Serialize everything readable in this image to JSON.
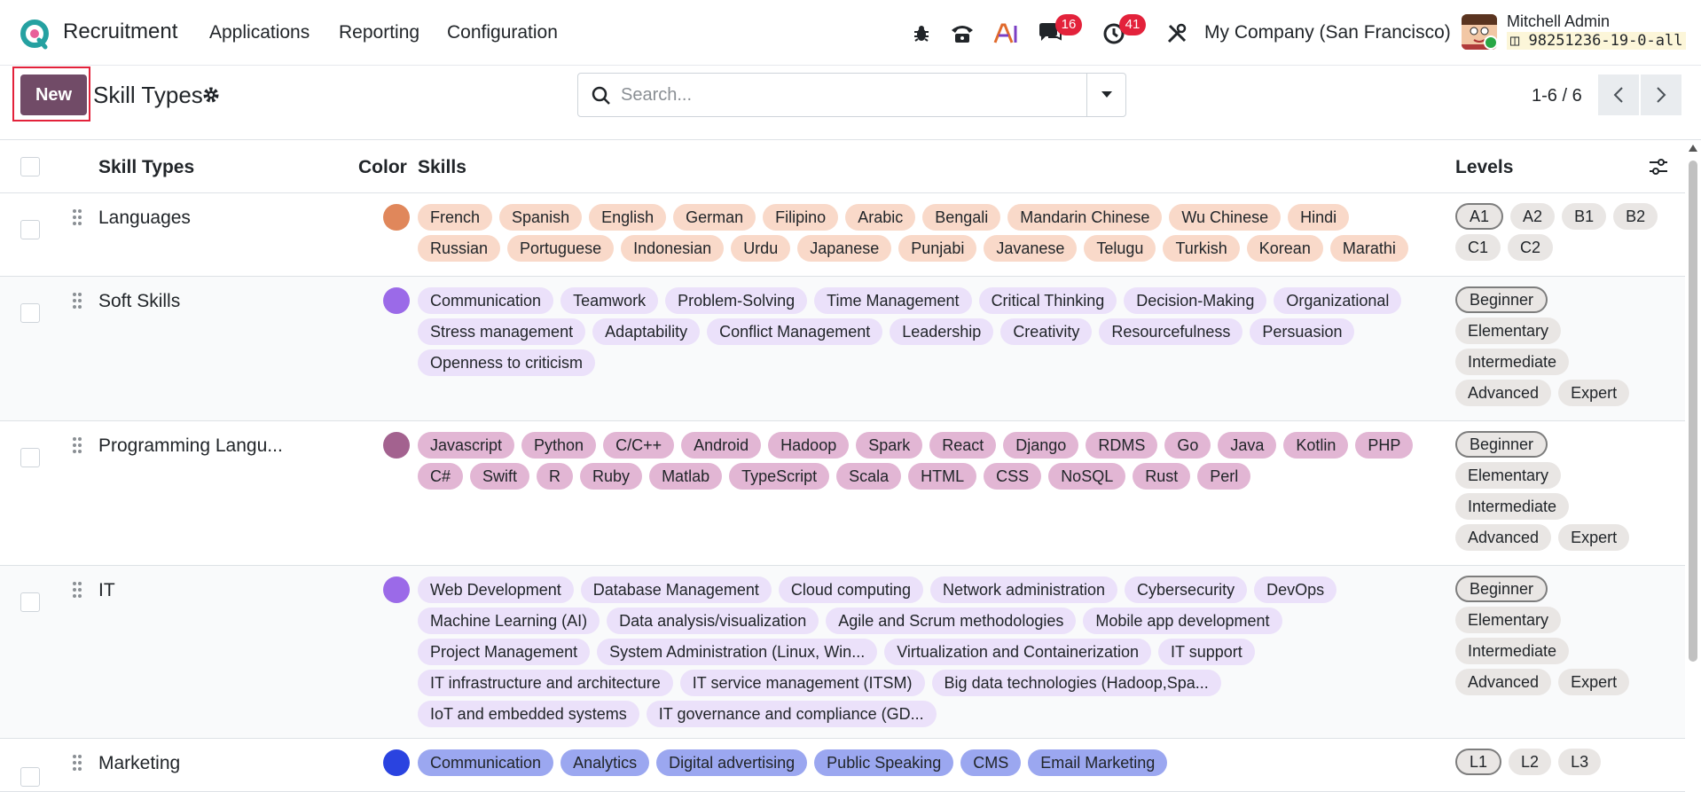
{
  "navbar": {
    "app_name": "Recruitment",
    "menu": [
      "Applications",
      "Reporting",
      "Configuration"
    ],
    "chat_badge": "16",
    "activity_badge": "41",
    "company": "My Company (San Francisco)",
    "user_name": "Mitchell Admin",
    "db_name": "98251236-19-0-all"
  },
  "control": {
    "new_label": "New",
    "title": "Skill Types",
    "search_placeholder": "Search...",
    "pager": "1-6 / 6"
  },
  "table": {
    "headers": {
      "name": "Skill Types",
      "color": "Color",
      "skills": "Skills",
      "levels": "Levels"
    },
    "rows": [
      {
        "name": "Languages",
        "color": "#e0875b",
        "tag_bg": "#f9d9c9",
        "skills": [
          "French",
          "Spanish",
          "English",
          "German",
          "Filipino",
          "Arabic",
          "Bengali",
          "Mandarin Chinese",
          "Wu Chinese",
          "Hindi",
          "Russian",
          "Portuguese",
          "Indonesian",
          "Urdu",
          "Japanese",
          "Punjabi",
          "Javanese",
          "Telugu",
          "Turkish",
          "Korean",
          "Marathi"
        ],
        "levels": [
          "A1",
          "A2",
          "B1",
          "B2",
          "C1",
          "C2"
        ]
      },
      {
        "name": "Soft Skills",
        "color": "#9b6ae8",
        "tag_bg": "#ebe1fa",
        "skills": [
          "Communication",
          "Teamwork",
          "Problem-Solving",
          "Time Management",
          "Critical Thinking",
          "Decision-Making",
          "Organizational",
          "Stress management",
          "Adaptability",
          "Conflict Management",
          "Leadership",
          "Creativity",
          "Resourcefulness",
          "Persuasion",
          "Openness to criticism"
        ],
        "levels": [
          "Beginner",
          "Elementary",
          "Intermediate",
          "Advanced",
          "Expert"
        ]
      },
      {
        "name": "Programming Langu...",
        "color": "#a3628f",
        "tag_bg": "#e2b6d4",
        "skills": [
          "Javascript",
          "Python",
          "C/C++",
          "Android",
          "Hadoop",
          "Spark",
          "React",
          "Django",
          "RDMS",
          "Go",
          "Java",
          "Kotlin",
          "PHP",
          "C#",
          "Swift",
          "R",
          "Ruby",
          "Matlab",
          "TypeScript",
          "Scala",
          "HTML",
          "CSS",
          "NoSQL",
          "Rust",
          "Perl"
        ],
        "levels": [
          "Beginner",
          "Elementary",
          "Intermediate",
          "Advanced",
          "Expert"
        ]
      },
      {
        "name": "IT",
        "color": "#9b6ae8",
        "tag_bg": "#ebe1fa",
        "skills": [
          "Web Development",
          "Database Management",
          "Cloud computing",
          "Network administration",
          "Cybersecurity",
          "DevOps",
          "Machine Learning (AI)",
          "Data analysis/visualization",
          "Agile and Scrum methodologies",
          "Mobile app development",
          "Project Management",
          "System Administration (Linux, Win...",
          "Virtualization and Containerization",
          "IT support",
          "IT infrastructure and architecture",
          "IT service management (ITSM)",
          "Big data technologies (Hadoop,Spa...",
          "IoT and embedded systems",
          "IT governance and compliance (GD..."
        ],
        "levels": [
          "Beginner",
          "Elementary",
          "Intermediate",
          "Advanced",
          "Expert"
        ]
      },
      {
        "name": "Marketing",
        "color": "#2a43e0",
        "tag_bg": "#9ba7f0",
        "skills": [
          "Communication",
          "Analytics",
          "Digital advertising",
          "Public Speaking",
          "CMS",
          "Email Marketing"
        ],
        "levels": [
          "L1",
          "L2",
          "L3"
        ]
      }
    ]
  }
}
